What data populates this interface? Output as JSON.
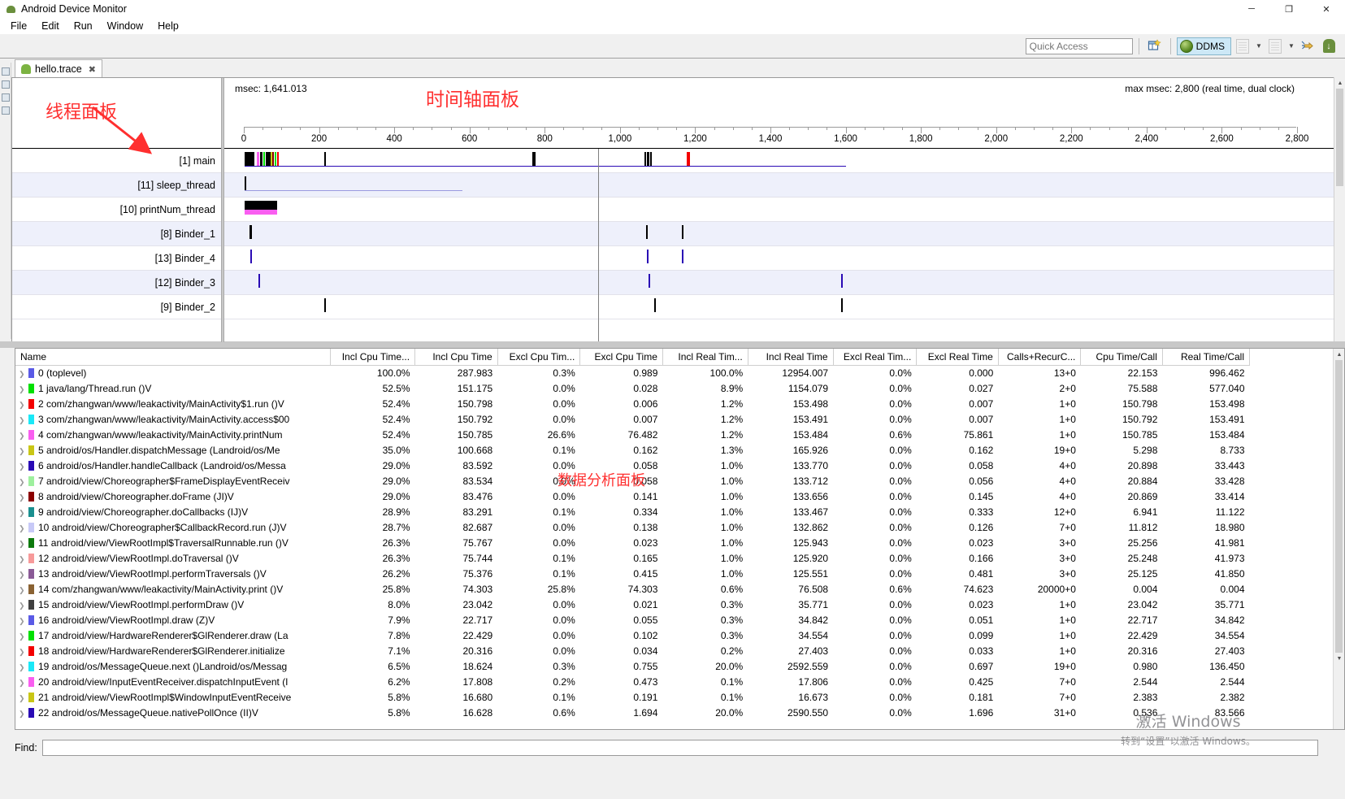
{
  "window": {
    "title": "Android Device Monitor",
    "minimize": "─",
    "maximize": "❐",
    "close": "✕"
  },
  "menu": {
    "items": [
      "File",
      "Edit",
      "Run",
      "Window",
      "Help"
    ]
  },
  "toolbar": {
    "quick_access_placeholder": "Quick Access",
    "perspective_label": "DDMS",
    "icons": [
      "new-perspective-icon",
      "ddms-perspective-icon",
      "import-icon",
      "export-icon",
      "tracer-icon",
      "sdk-download-icon"
    ]
  },
  "editor_tab": {
    "label": "hello.trace",
    "close": "✖"
  },
  "annotations": {
    "thread_panel": "线程面板",
    "timeline_panel": "时间轴面板",
    "data_panel": "数据分析面板"
  },
  "timeline": {
    "msec_label": "msec: 1,641.013",
    "max_label": "max msec: 2,800 (real time, dual clock)",
    "ticks": [
      0,
      200,
      400,
      600,
      800,
      1000,
      1200,
      1400,
      1600,
      1800,
      2000,
      2200,
      2400,
      2600,
      2800
    ],
    "tick_labels": [
      "0",
      "200",
      "400",
      "600",
      "800",
      "1,000",
      "1,200",
      "1,400",
      "1,600",
      "1,800",
      "2,000",
      "2,200",
      "2,400",
      "2,600",
      "2,800"
    ],
    "axis_max": 2800,
    "cursor_msec": 1641.013,
    "threads": [
      {
        "label": "[1] main"
      },
      {
        "label": "[11] sleep_thread"
      },
      {
        "label": "[10] printNum_thread"
      },
      {
        "label": "[8] Binder_1"
      },
      {
        "label": "[13] Binder_4"
      },
      {
        "label": "[12] Binder_3"
      },
      {
        "label": "[9] Binder_2"
      }
    ]
  },
  "table": {
    "columns": [
      "Name",
      "Incl Cpu Time...",
      "Incl Cpu Time",
      "Excl Cpu Tim...",
      "Excl Cpu Time",
      "Incl Real Tim...",
      "Incl Real Time",
      "Excl Real Tim...",
      "Excl Real Time",
      "Calls+RecurC...",
      "Cpu Time/Call",
      "Real Time/Call"
    ],
    "rows": [
      {
        "color": "#5a5ae6",
        "name": "0 (toplevel)",
        "incl_cpu_pct": "100.0%",
        "incl_cpu": "287.983",
        "excl_cpu_pct": "0.3%",
        "excl_cpu": "0.989",
        "incl_real_pct": "100.0%",
        "incl_real": "12954.007",
        "excl_real_pct": "0.0%",
        "excl_real": "0.000",
        "calls": "13+0",
        "cpu_per_call": "22.153",
        "real_per_call": "996.462"
      },
      {
        "color": "#00e000",
        "name": "1 java/lang/Thread.run ()V",
        "incl_cpu_pct": "52.5%",
        "incl_cpu": "151.175",
        "excl_cpu_pct": "0.0%",
        "excl_cpu": "0.028",
        "incl_real_pct": "8.9%",
        "incl_real": "1154.079",
        "excl_real_pct": "0.0%",
        "excl_real": "0.027",
        "calls": "2+0",
        "cpu_per_call": "75.588",
        "real_per_call": "577.040"
      },
      {
        "color": "#f30000",
        "name": "2 com/zhangwan/www/leakactivity/MainActivity$1.run ()V",
        "incl_cpu_pct": "52.4%",
        "incl_cpu": "150.798",
        "excl_cpu_pct": "0.0%",
        "excl_cpu": "0.006",
        "incl_real_pct": "1.2%",
        "incl_real": "153.498",
        "excl_real_pct": "0.0%",
        "excl_real": "0.007",
        "calls": "1+0",
        "cpu_per_call": "150.798",
        "real_per_call": "153.498"
      },
      {
        "color": "#1ae8f7",
        "name": "3 com/zhangwan/www/leakactivity/MainActivity.access$00",
        "incl_cpu_pct": "52.4%",
        "incl_cpu": "150.792",
        "excl_cpu_pct": "0.0%",
        "excl_cpu": "0.007",
        "incl_real_pct": "1.2%",
        "incl_real": "153.491",
        "excl_real_pct": "0.0%",
        "excl_real": "0.007",
        "calls": "1+0",
        "cpu_per_call": "150.792",
        "real_per_call": "153.491"
      },
      {
        "color": "#f95ef0",
        "name": "4 com/zhangwan/www/leakactivity/MainActivity.printNum",
        "incl_cpu_pct": "52.4%",
        "incl_cpu": "150.785",
        "excl_cpu_pct": "26.6%",
        "excl_cpu": "76.482",
        "incl_real_pct": "1.2%",
        "incl_real": "153.484",
        "excl_real_pct": "0.6%",
        "excl_real": "75.861",
        "calls": "1+0",
        "cpu_per_call": "150.785",
        "real_per_call": "153.484"
      },
      {
        "color": "#c9c615",
        "name": "5 android/os/Handler.dispatchMessage (Landroid/os/Me",
        "incl_cpu_pct": "35.0%",
        "incl_cpu": "100.668",
        "excl_cpu_pct": "0.1%",
        "excl_cpu": "0.162",
        "incl_real_pct": "1.3%",
        "incl_real": "165.926",
        "excl_real_pct": "0.0%",
        "excl_real": "0.162",
        "calls": "19+0",
        "cpu_per_call": "5.298",
        "real_per_call": "8.733"
      },
      {
        "color": "#2a0ab5",
        "name": "6 android/os/Handler.handleCallback (Landroid/os/Messa",
        "incl_cpu_pct": "29.0%",
        "incl_cpu": "83.592",
        "excl_cpu_pct": "0.0%",
        "excl_cpu": "0.058",
        "incl_real_pct": "1.0%",
        "incl_real": "133.770",
        "excl_real_pct": "0.0%",
        "excl_real": "0.058",
        "calls": "4+0",
        "cpu_per_call": "20.898",
        "real_per_call": "33.443"
      },
      {
        "color": "#9ef09e",
        "name": "7 android/view/Choreographer$FrameDisplayEventReceiv",
        "incl_cpu_pct": "29.0%",
        "incl_cpu": "83.534",
        "excl_cpu_pct": "0.0%",
        "excl_cpu": "0.058",
        "incl_real_pct": "1.0%",
        "incl_real": "133.712",
        "excl_real_pct": "0.0%",
        "excl_real": "0.056",
        "calls": "4+0",
        "cpu_per_call": "20.884",
        "real_per_call": "33.428"
      },
      {
        "color": "#8b0000",
        "name": "8 android/view/Choreographer.doFrame (JI)V",
        "incl_cpu_pct": "29.0%",
        "incl_cpu": "83.476",
        "excl_cpu_pct": "0.0%",
        "excl_cpu": "0.141",
        "incl_real_pct": "1.0%",
        "incl_real": "133.656",
        "excl_real_pct": "0.0%",
        "excl_real": "0.145",
        "calls": "4+0",
        "cpu_per_call": "20.869",
        "real_per_call": "33.414"
      },
      {
        "color": "#1a8f8f",
        "name": "9 android/view/Choreographer.doCallbacks (IJ)V",
        "incl_cpu_pct": "28.9%",
        "incl_cpu": "83.291",
        "excl_cpu_pct": "0.1%",
        "excl_cpu": "0.334",
        "incl_real_pct": "1.0%",
        "incl_real": "133.467",
        "excl_real_pct": "0.0%",
        "excl_real": "0.333",
        "calls": "12+0",
        "cpu_per_call": "6.941",
        "real_per_call": "11.122"
      },
      {
        "color": "#c7c9f7",
        "name": "10 android/view/Choreographer$CallbackRecord.run (J)V",
        "incl_cpu_pct": "28.7%",
        "incl_cpu": "82.687",
        "excl_cpu_pct": "0.0%",
        "excl_cpu": "0.138",
        "incl_real_pct": "1.0%",
        "incl_real": "132.862",
        "excl_real_pct": "0.0%",
        "excl_real": "0.126",
        "calls": "7+0",
        "cpu_per_call": "11.812",
        "real_per_call": "18.980"
      },
      {
        "color": "#0d7a0d",
        "name": "11 android/view/ViewRootImpl$TraversalRunnable.run ()V",
        "incl_cpu_pct": "26.3%",
        "incl_cpu": "75.767",
        "excl_cpu_pct": "0.0%",
        "excl_cpu": "0.023",
        "incl_real_pct": "1.0%",
        "incl_real": "125.943",
        "excl_real_pct": "0.0%",
        "excl_real": "0.023",
        "calls": "3+0",
        "cpu_per_call": "25.256",
        "real_per_call": "41.981"
      },
      {
        "color": "#f79a9a",
        "name": "12 android/view/ViewRootImpl.doTraversal ()V",
        "incl_cpu_pct": "26.3%",
        "incl_cpu": "75.744",
        "excl_cpu_pct": "0.1%",
        "excl_cpu": "0.165",
        "incl_real_pct": "1.0%",
        "incl_real": "125.920",
        "excl_real_pct": "0.0%",
        "excl_real": "0.166",
        "calls": "3+0",
        "cpu_per_call": "25.248",
        "real_per_call": "41.973"
      },
      {
        "color": "#8a5a96",
        "name": "13 android/view/ViewRootImpl.performTraversals ()V",
        "incl_cpu_pct": "26.2%",
        "incl_cpu": "75.376",
        "excl_cpu_pct": "0.1%",
        "excl_cpu": "0.415",
        "incl_real_pct": "1.0%",
        "incl_real": "125.551",
        "excl_real_pct": "0.0%",
        "excl_real": "0.481",
        "calls": "3+0",
        "cpu_per_call": "25.125",
        "real_per_call": "41.850"
      },
      {
        "color": "#8a6233",
        "name": "14 com/zhangwan/www/leakactivity/MainActivity.print ()V",
        "incl_cpu_pct": "25.8%",
        "incl_cpu": "74.303",
        "excl_cpu_pct": "25.8%",
        "excl_cpu": "74.303",
        "incl_real_pct": "0.6%",
        "incl_real": "76.508",
        "excl_real_pct": "0.6%",
        "excl_real": "74.623",
        "calls": "20000+0",
        "cpu_per_call": "0.004",
        "real_per_call": "0.004"
      },
      {
        "color": "#404040",
        "name": "15 android/view/ViewRootImpl.performDraw ()V",
        "incl_cpu_pct": "8.0%",
        "incl_cpu": "23.042",
        "excl_cpu_pct": "0.0%",
        "excl_cpu": "0.021",
        "incl_real_pct": "0.3%",
        "incl_real": "35.771",
        "excl_real_pct": "0.0%",
        "excl_real": "0.023",
        "calls": "1+0",
        "cpu_per_call": "23.042",
        "real_per_call": "35.771"
      },
      {
        "color": "#5a5ae6",
        "name": "16 android/view/ViewRootImpl.draw (Z)V",
        "incl_cpu_pct": "7.9%",
        "incl_cpu": "22.717",
        "excl_cpu_pct": "0.0%",
        "excl_cpu": "0.055",
        "incl_real_pct": "0.3%",
        "incl_real": "34.842",
        "excl_real_pct": "0.0%",
        "excl_real": "0.051",
        "calls": "1+0",
        "cpu_per_call": "22.717",
        "real_per_call": "34.842"
      },
      {
        "color": "#00e000",
        "name": "17 android/view/HardwareRenderer$GlRenderer.draw (La",
        "incl_cpu_pct": "7.8%",
        "incl_cpu": "22.429",
        "excl_cpu_pct": "0.0%",
        "excl_cpu": "0.102",
        "incl_real_pct": "0.3%",
        "incl_real": "34.554",
        "excl_real_pct": "0.0%",
        "excl_real": "0.099",
        "calls": "1+0",
        "cpu_per_call": "22.429",
        "real_per_call": "34.554"
      },
      {
        "color": "#f30000",
        "name": "18 android/view/HardwareRenderer$GlRenderer.initialize",
        "incl_cpu_pct": "7.1%",
        "incl_cpu": "20.316",
        "excl_cpu_pct": "0.0%",
        "excl_cpu": "0.034",
        "incl_real_pct": "0.2%",
        "incl_real": "27.403",
        "excl_real_pct": "0.0%",
        "excl_real": "0.033",
        "calls": "1+0",
        "cpu_per_call": "20.316",
        "real_per_call": "27.403"
      },
      {
        "color": "#1ae8f7",
        "name": "19 android/os/MessageQueue.next ()Landroid/os/Messag",
        "incl_cpu_pct": "6.5%",
        "incl_cpu": "18.624",
        "excl_cpu_pct": "0.3%",
        "excl_cpu": "0.755",
        "incl_real_pct": "20.0%",
        "incl_real": "2592.559",
        "excl_real_pct": "0.0%",
        "excl_real": "0.697",
        "calls": "19+0",
        "cpu_per_call": "0.980",
        "real_per_call": "136.450"
      },
      {
        "color": "#f95ef0",
        "name": "20 android/view/InputEventReceiver.dispatchInputEvent (I",
        "incl_cpu_pct": "6.2%",
        "incl_cpu": "17.808",
        "excl_cpu_pct": "0.2%",
        "excl_cpu": "0.473",
        "incl_real_pct": "0.1%",
        "incl_real": "17.806",
        "excl_real_pct": "0.0%",
        "excl_real": "0.425",
        "calls": "7+0",
        "cpu_per_call": "2.544",
        "real_per_call": "2.544"
      },
      {
        "color": "#c9c615",
        "name": "21 android/view/ViewRootImpl$WindowInputEventReceive",
        "incl_cpu_pct": "5.8%",
        "incl_cpu": "16.680",
        "excl_cpu_pct": "0.1%",
        "excl_cpu": "0.191",
        "incl_real_pct": "0.1%",
        "incl_real": "16.673",
        "excl_real_pct": "0.0%",
        "excl_real": "0.181",
        "calls": "7+0",
        "cpu_per_call": "2.383",
        "real_per_call": "2.382"
      },
      {
        "color": "#2a0ab5",
        "name": "22 android/os/MessageQueue.nativePollOnce (II)V",
        "incl_cpu_pct": "5.8%",
        "incl_cpu": "16.628",
        "excl_cpu_pct": "0.6%",
        "excl_cpu": "1.694",
        "incl_real_pct": "20.0%",
        "incl_real": "2590.550",
        "excl_real_pct": "0.0%",
        "excl_real": "1.696",
        "calls": "31+0",
        "cpu_per_call": "0.536",
        "real_per_call": "83.566"
      }
    ]
  },
  "find": {
    "label": "Find:",
    "value": ""
  },
  "watermark": {
    "line1": "激活 Windows",
    "line2": "转到“设置”以激活 Windows。"
  }
}
